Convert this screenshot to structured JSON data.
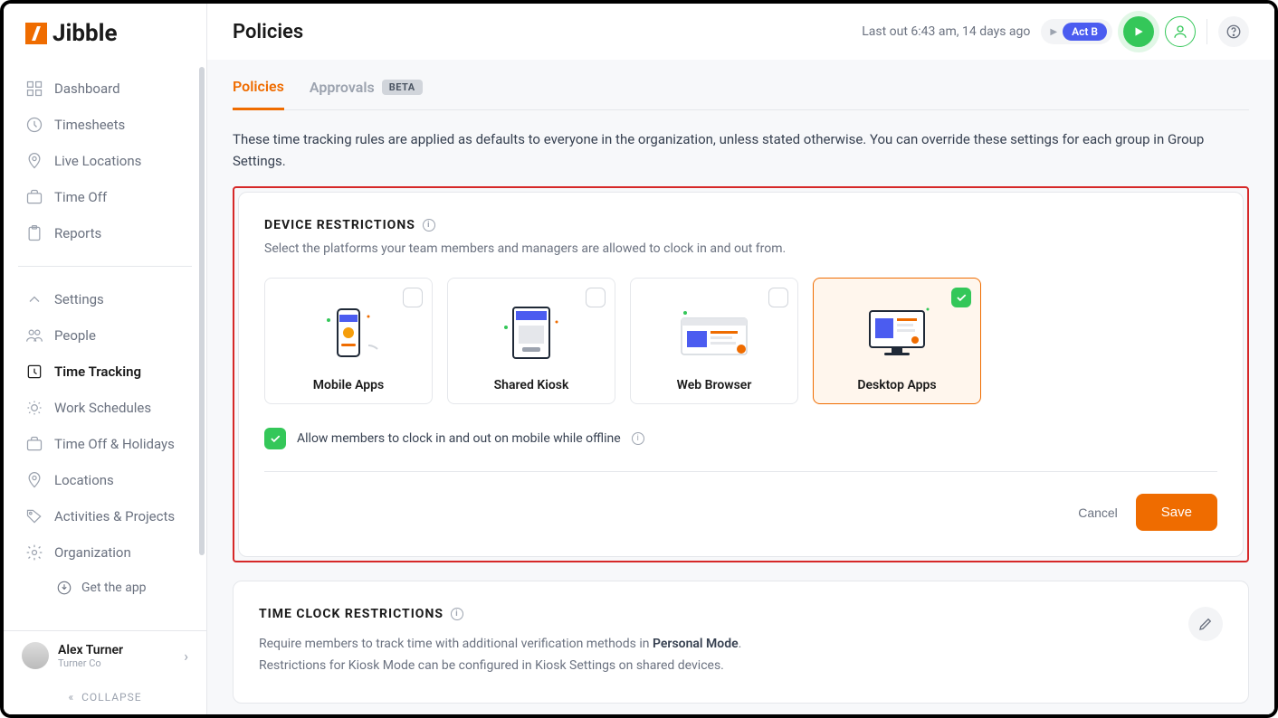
{
  "logo_text": "Jibble",
  "header": {
    "title": "Policies",
    "status": "Last out 6:43 am, 14 days ago",
    "act_label": "Act B"
  },
  "sidebar": {
    "nav1": [
      {
        "label": "Dashboard"
      },
      {
        "label": "Timesheets"
      },
      {
        "label": "Live Locations"
      },
      {
        "label": "Time Off"
      },
      {
        "label": "Reports"
      }
    ],
    "nav2": [
      {
        "label": "Settings"
      },
      {
        "label": "People"
      },
      {
        "label": "Time Tracking"
      },
      {
        "label": "Work Schedules"
      },
      {
        "label": "Time Off & Holidays"
      },
      {
        "label": "Locations"
      },
      {
        "label": "Activities & Projects"
      },
      {
        "label": "Organization"
      }
    ],
    "get_app": "Get the app",
    "user_name": "Alex Turner",
    "user_org": "Turner Co",
    "collapse": "COLLAPSE"
  },
  "tabs": {
    "policies": "Policies",
    "approvals": "Approvals",
    "beta": "BETA"
  },
  "policies_description": "These time tracking rules are applied as defaults to everyone in the organization, unless stated otherwise. You can override these settings for each group in Group Settings.",
  "device_restrictions": {
    "title": "DEVICE RESTRICTIONS",
    "subtitle": "Select the platforms your team members and managers are allowed to clock in and out from.",
    "options": [
      {
        "label": "Mobile Apps",
        "selected": false
      },
      {
        "label": "Shared Kiosk",
        "selected": false
      },
      {
        "label": "Web Browser",
        "selected": false
      },
      {
        "label": "Desktop Apps",
        "selected": true
      }
    ],
    "offline_label": "Allow members to clock in and out on mobile while offline",
    "offline_checked": true,
    "cancel": "Cancel",
    "save": "Save"
  },
  "time_clock": {
    "title": "TIME CLOCK RESTRICTIONS",
    "line1_a": "Require members to track time with additional verification methods in ",
    "line1_b": "Personal Mode",
    "line1_c": ".",
    "line2": "Restrictions for Kiosk Mode can be configured in Kiosk Settings on shared devices."
  }
}
